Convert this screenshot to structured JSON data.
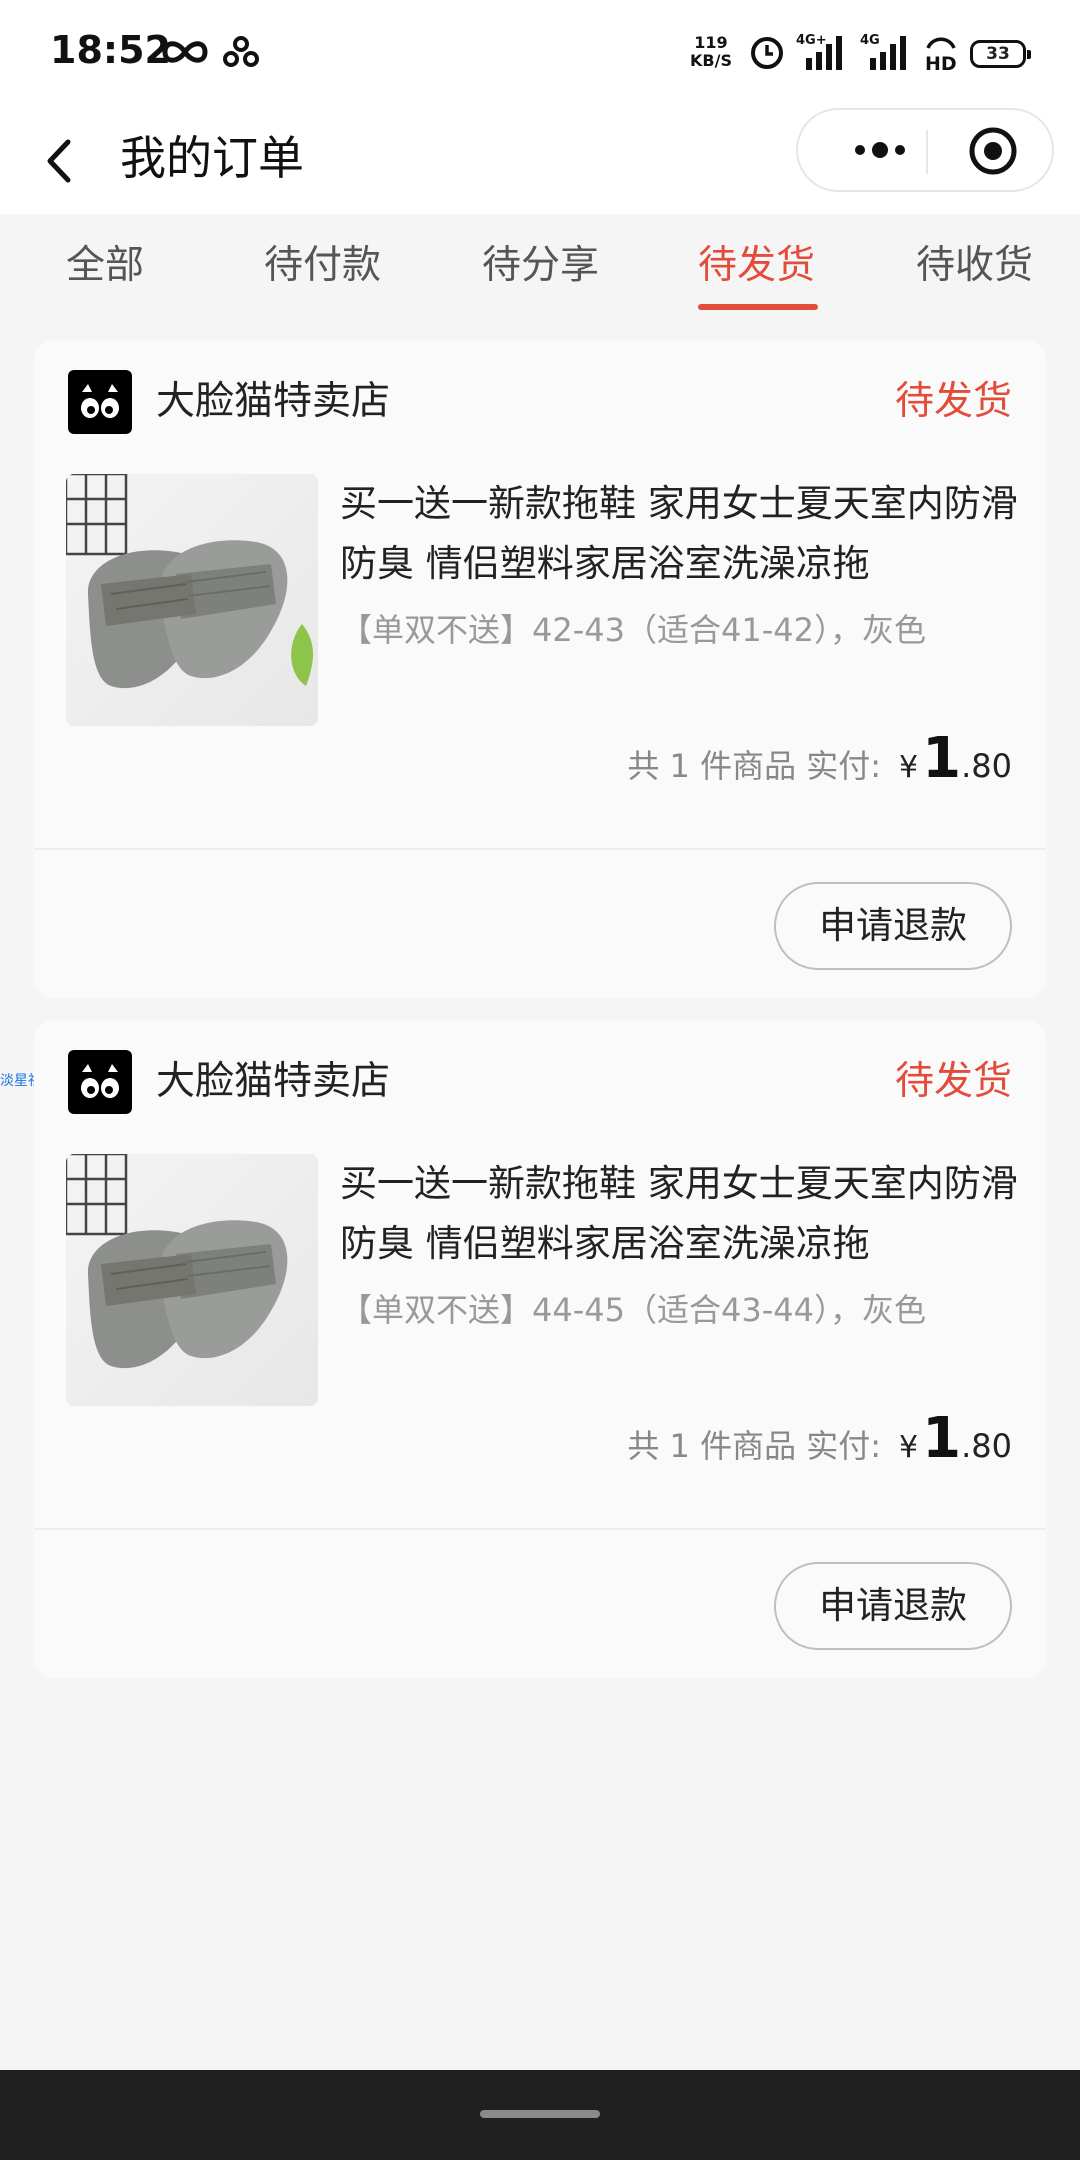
{
  "status_bar": {
    "time": "18:52",
    "net_speed_value": "119",
    "net_speed_unit": "KB/S",
    "signal1_label": "4G+",
    "signal2_label": "4G",
    "hd_label": "HD",
    "battery": "33"
  },
  "nav": {
    "title": "我的订单"
  },
  "tabs": [
    {
      "label": "全部"
    },
    {
      "label": "待付款"
    },
    {
      "label": "待分享"
    },
    {
      "label": "待发货"
    },
    {
      "label": "待收货"
    }
  ],
  "active_tab": "待发货",
  "orders": [
    {
      "shop_name": "大脸猫特卖店",
      "status": "待发货",
      "product_title": "买一送一新款拖鞋 家用女士夏天室内防滑防臭 情侣塑料家居浴室洗澡凉拖",
      "product_spec": "【单双不送】42-43（适合41-42），灰色",
      "summary_text": "共 1 件商品 实付:",
      "currency": "¥",
      "price_int": "1",
      "price_dec": ".80",
      "refund_label": "申请退款"
    },
    {
      "shop_name": "大脸猫特卖店",
      "status": "待发货",
      "product_title": "买一送一新款拖鞋 家用女士夏天室内防滑防臭 情侣塑料家居浴室洗澡凉拖",
      "product_spec": "【单双不送】44-45（适合43-44），灰色",
      "summary_text": "共 1 件商品 实付:",
      "currency": "¥",
      "price_int": "1",
      "price_dec": ".80",
      "refund_label": "申请退款"
    }
  ],
  "watermark": "淡星社区",
  "colors": {
    "accent": "#e34c3b",
    "page_bg": "#f5f5f5",
    "card_bg": "#fafafa"
  },
  "icons": {
    "back": "chevron-left-icon",
    "more": "more-dots-icon",
    "close": "target-circle-icon",
    "shop_logo": "cat-face-logo"
  }
}
